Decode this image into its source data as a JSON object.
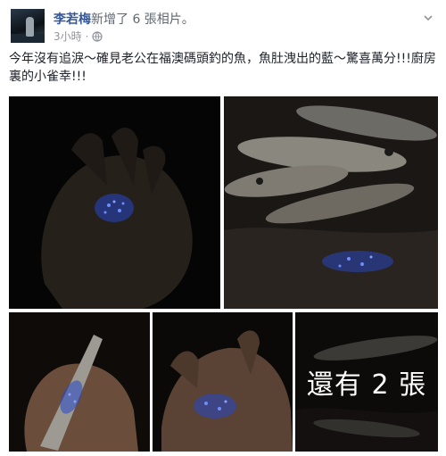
{
  "post": {
    "author_name": "李若梅",
    "action_text": "新增了 6 張相片。",
    "timestamp": "3小時",
    "audience_icon": "globe-icon",
    "menu_icon": "chevron-down-icon",
    "text": "今年沒有追淚～確見老公在福澳碼頭釣的魚，魚肚洩出的藍～驚喜萬分!!!廚房裏的小雀幸!!!",
    "photo_count": 6,
    "more_photos_label": "還有 2 張"
  },
  "colors": {
    "author_link": "#365899",
    "meta_text": "#90949c",
    "glow_blue": "#3b5cff"
  }
}
